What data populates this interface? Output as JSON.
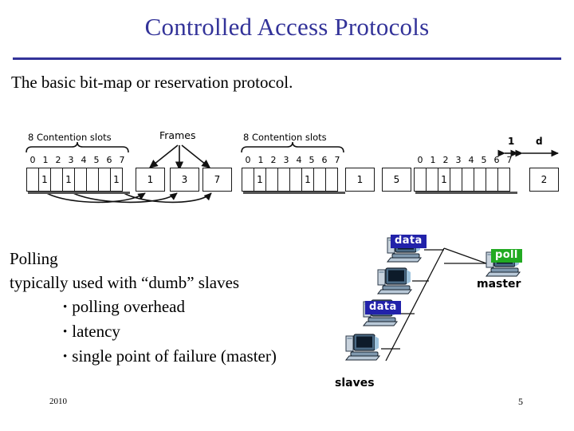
{
  "slide": {
    "title": "Controlled Access Protocols",
    "subtitle": "The basic bit-map or reservation protocol.",
    "footer_year": "2010",
    "page_number": "5",
    "title_color": "#333399"
  },
  "bitmap_diagram": {
    "frames_label": "Frames",
    "group_label": "8 Contention slots",
    "slot_indices": [
      "0",
      "1",
      "2",
      "3",
      "4",
      "5",
      "6",
      "7"
    ],
    "groups": [
      {
        "id": "group-1",
        "label": "8 Contention slots",
        "show_label": true,
        "show_indices": true,
        "slots": [
          "",
          "1",
          "",
          "1",
          "",
          "",
          "",
          "1"
        ]
      },
      {
        "id": "group-2",
        "label": "8 Contention slots",
        "show_label": true,
        "show_indices": true,
        "slots": [
          "",
          "1",
          "",
          "",
          "",
          "1",
          "",
          ""
        ]
      },
      {
        "id": "group-3",
        "label": "",
        "show_label": false,
        "show_indices": true,
        "slots": [
          "",
          "",
          "1",
          "",
          "",
          "",
          "",
          ""
        ]
      }
    ],
    "frame_groups": [
      {
        "id": "frames-1",
        "frames": [
          "1",
          "3",
          "7"
        ]
      },
      {
        "id": "frames-2",
        "frames": [
          "1",
          "5"
        ]
      },
      {
        "id": "frames-3",
        "frames": [
          "2"
        ]
      }
    ],
    "measure_labels": [
      {
        "id": "measure-one",
        "text": "1"
      },
      {
        "id": "measure-d",
        "text": "d"
      }
    ]
  },
  "polling": {
    "heading": "Polling",
    "subheading": "typically used with “dumb” slaves",
    "bullets": [
      "polling overhead",
      "latency",
      "single point of failure (master)"
    ],
    "bullet_glyph": "•"
  },
  "network": {
    "master_label": "master",
    "slaves_label": "slaves",
    "master_tag": "poll",
    "master_tag_color": "#22aa22",
    "data_tag": "data",
    "data_tag_color": "#2222aa",
    "nodes": [
      {
        "id": "slave-1",
        "tag": "data",
        "has_tag": true
      },
      {
        "id": "slave-2",
        "tag": "",
        "has_tag": false
      },
      {
        "id": "slave-3",
        "tag": "data",
        "has_tag": true
      },
      {
        "id": "slave-4",
        "tag": "",
        "has_tag": false
      },
      {
        "id": "master",
        "tag": "poll",
        "has_tag": true
      }
    ]
  }
}
